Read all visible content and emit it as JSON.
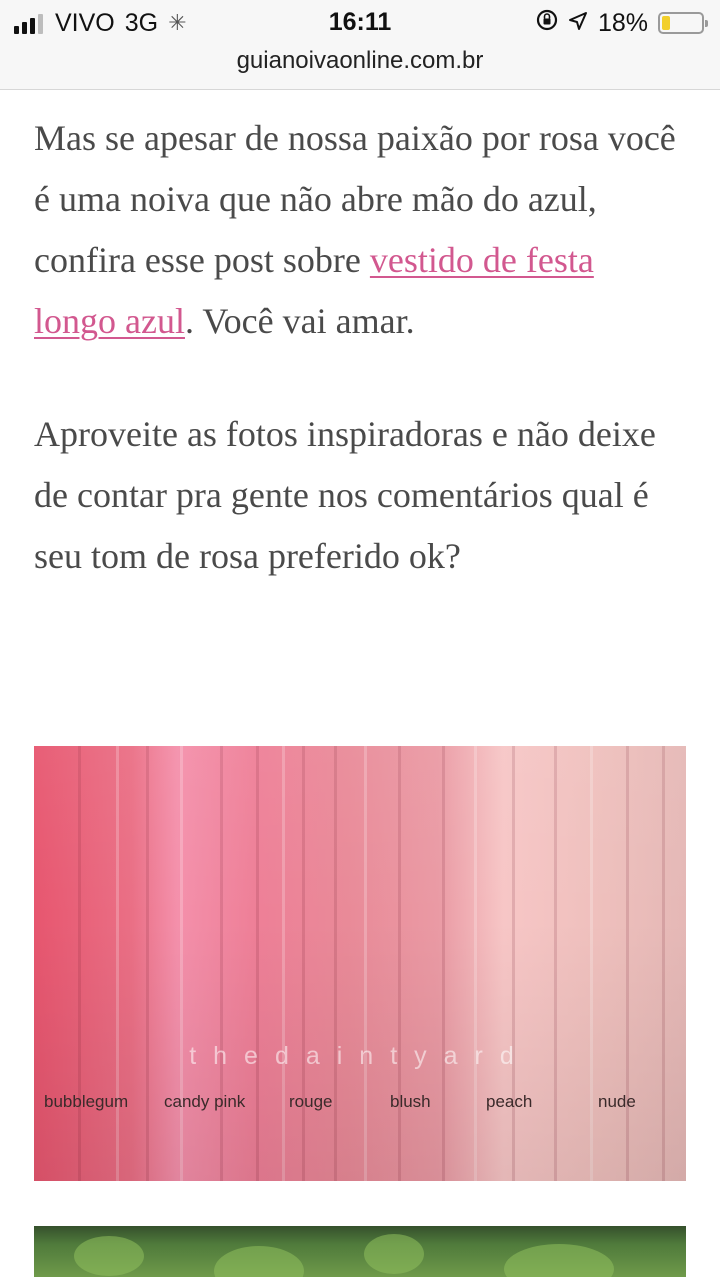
{
  "status_bar": {
    "carrier": "VIVO",
    "network": "3G",
    "time": "16:11",
    "battery_percent": "18%",
    "battery_level": 0.18
  },
  "url_bar": {
    "domain": "guianoivaonline.com.br"
  },
  "article": {
    "para1_text_before_link": "Mas se apesar de nossa paixão por rosa você é uma noiva que não abre mão do azul, confira esse post sobre ",
    "para1_link": "vestido de festa longo azul",
    "para1_text_after_link": ". Você vai amar.",
    "para2": "Aproveite as fotos inspiradoras e não deixe de contar pra gente nos comentários qual é seu tom de rosa preferido ok?"
  },
  "photo": {
    "watermark": "thedaintyard",
    "shade_labels": [
      "bubblegum",
      "candy pink",
      "rouge",
      "blush",
      "peach",
      "nude"
    ]
  },
  "colors": {
    "link": "#d2588f",
    "body_text": "#4a4a4a",
    "battery": "#f2cf2b"
  }
}
